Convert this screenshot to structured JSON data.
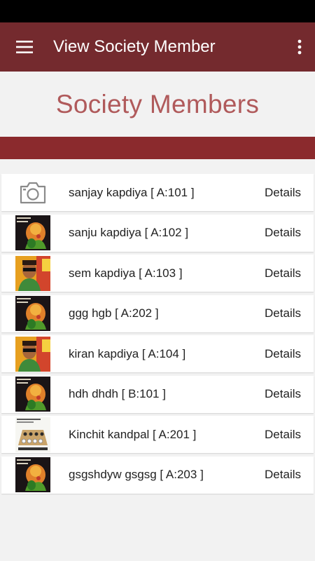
{
  "app_bar": {
    "title": "View Society Member",
    "menu_icon": "hamburger-menu-icon",
    "overflow_icon": "more-vert-icon",
    "color": "#742a2e"
  },
  "header": {
    "title": "Society Members",
    "title_color": "#b05a5b",
    "band_color": "#8b2a2d"
  },
  "members": [
    {
      "name": "sanjay kapdiya [ A:101 ]",
      "photo": "camera-placeholder-icon",
      "action": "Details"
    },
    {
      "name": "sanju kapdiya [ A:102 ]",
      "photo": "ganesha-photo",
      "action": "Details"
    },
    {
      "name": "sem kapdiya [ A:103 ]",
      "photo": "boy-photo",
      "action": "Details"
    },
    {
      "name": "ggg hgb [ A:202 ]",
      "photo": "ganesha-photo",
      "action": "Details"
    },
    {
      "name": "kiran kapdiya [ A:104 ]",
      "photo": "boy-photo",
      "action": "Details"
    },
    {
      "name": "hdh dhdh [ B:101 ]",
      "photo": "ganesha-photo",
      "action": "Details"
    },
    {
      "name": "Kinchit kandpal [ A:201 ]",
      "photo": "chess-photo",
      "action": "Details"
    },
    {
      "name": "gsgshdyw gsgsg [ A:203 ]",
      "photo": "ganesha-photo",
      "action": "Details"
    }
  ]
}
